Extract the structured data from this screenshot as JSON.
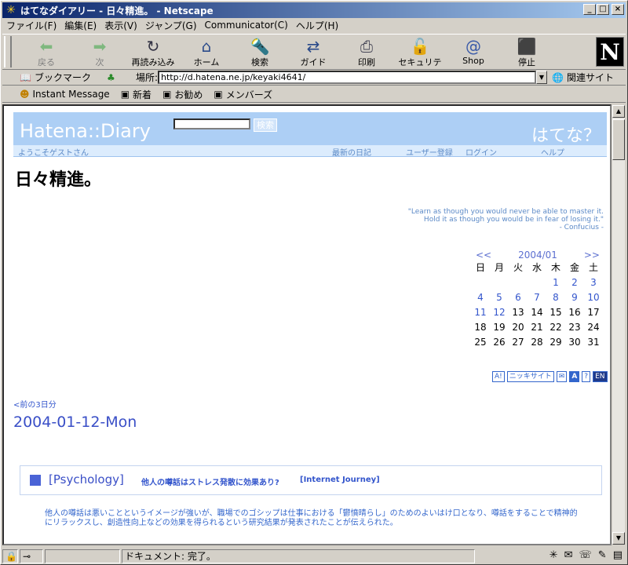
{
  "window": {
    "title": "はてなダイアリー - 日々精進。 - Netscape"
  },
  "menu": [
    "ファイル(F)",
    "編集(E)",
    "表示(V)",
    "ジャンプ(G)",
    "Communicator(C)",
    "ヘルプ(H)"
  ],
  "toolbar": {
    "back": "戻る",
    "forward": "次",
    "reload": "再読み込み",
    "home": "ホーム",
    "search": "検索",
    "guide": "ガイド",
    "print": "印刷",
    "security": "セキュリティ",
    "shop": "Shop",
    "stop": "停止"
  },
  "location": {
    "bookmarks": "ブックマーク",
    "label": "場所:",
    "url": "http://d.hatena.ne.jp/keyaki4641/",
    "related": "関連サイト"
  },
  "personal": [
    "Instant Message",
    "新着",
    "お勧め",
    "メンバーズ"
  ],
  "page": {
    "logo": "Hatena::Diary",
    "search_button": "検索",
    "hatena_q": "はてな？",
    "welcome": "ようこそゲストさん",
    "nav": [
      "最新の日記",
      "ユーザー登録",
      "ログイン",
      "ヘルプ"
    ],
    "diary_title": "日々精進。",
    "quote": [
      "\"Learn as though you would never be able to master it.",
      "Hold it as though you would be in fear of losing it.\"",
      "- Confucius -"
    ],
    "calendar": {
      "prev": "<<",
      "month": "2004/01",
      "next": ">>",
      "weekdays": [
        "日",
        "月",
        "火",
        "水",
        "木",
        "金",
        "土"
      ],
      "weeks": [
        [
          "",
          "",
          "",
          "",
          "1",
          "2",
          "3"
        ],
        [
          "4",
          "5",
          "6",
          "7",
          "8",
          "9",
          "10"
        ],
        [
          "11",
          "12",
          "13",
          "14",
          "15",
          "16",
          "17"
        ],
        [
          "18",
          "19",
          "20",
          "21",
          "22",
          "23",
          "24"
        ],
        [
          "25",
          "26",
          "27",
          "28",
          "29",
          "30",
          "31"
        ]
      ],
      "linked_days": [
        "1",
        "2",
        "3",
        "4",
        "5",
        "6",
        "7",
        "8",
        "9",
        "10",
        "11",
        "12"
      ]
    },
    "badges": [
      "A!",
      "ニッキサイト",
      "✉",
      "A",
      "?",
      "EN"
    ],
    "prev_days": "<前の3日分",
    "entry_date": "2004-01-12-Mon",
    "entry": {
      "category": "[Psychology]",
      "title": "他人の噂話はストレス発散に効果あり?",
      "source": "[Internet Journey]",
      "body": "他人の噂話は悪いことというイメージが強いが、職場でのゴシップは仕事における「鬱憤晴らし」のためのよいはけ口となり、噂話をすることで精神的にリラックスし、創造性向上などの効果を得られるという研究結果が発表されたことが伝えられた。"
    }
  },
  "status": {
    "text": "ドキュメント: 完了。"
  }
}
